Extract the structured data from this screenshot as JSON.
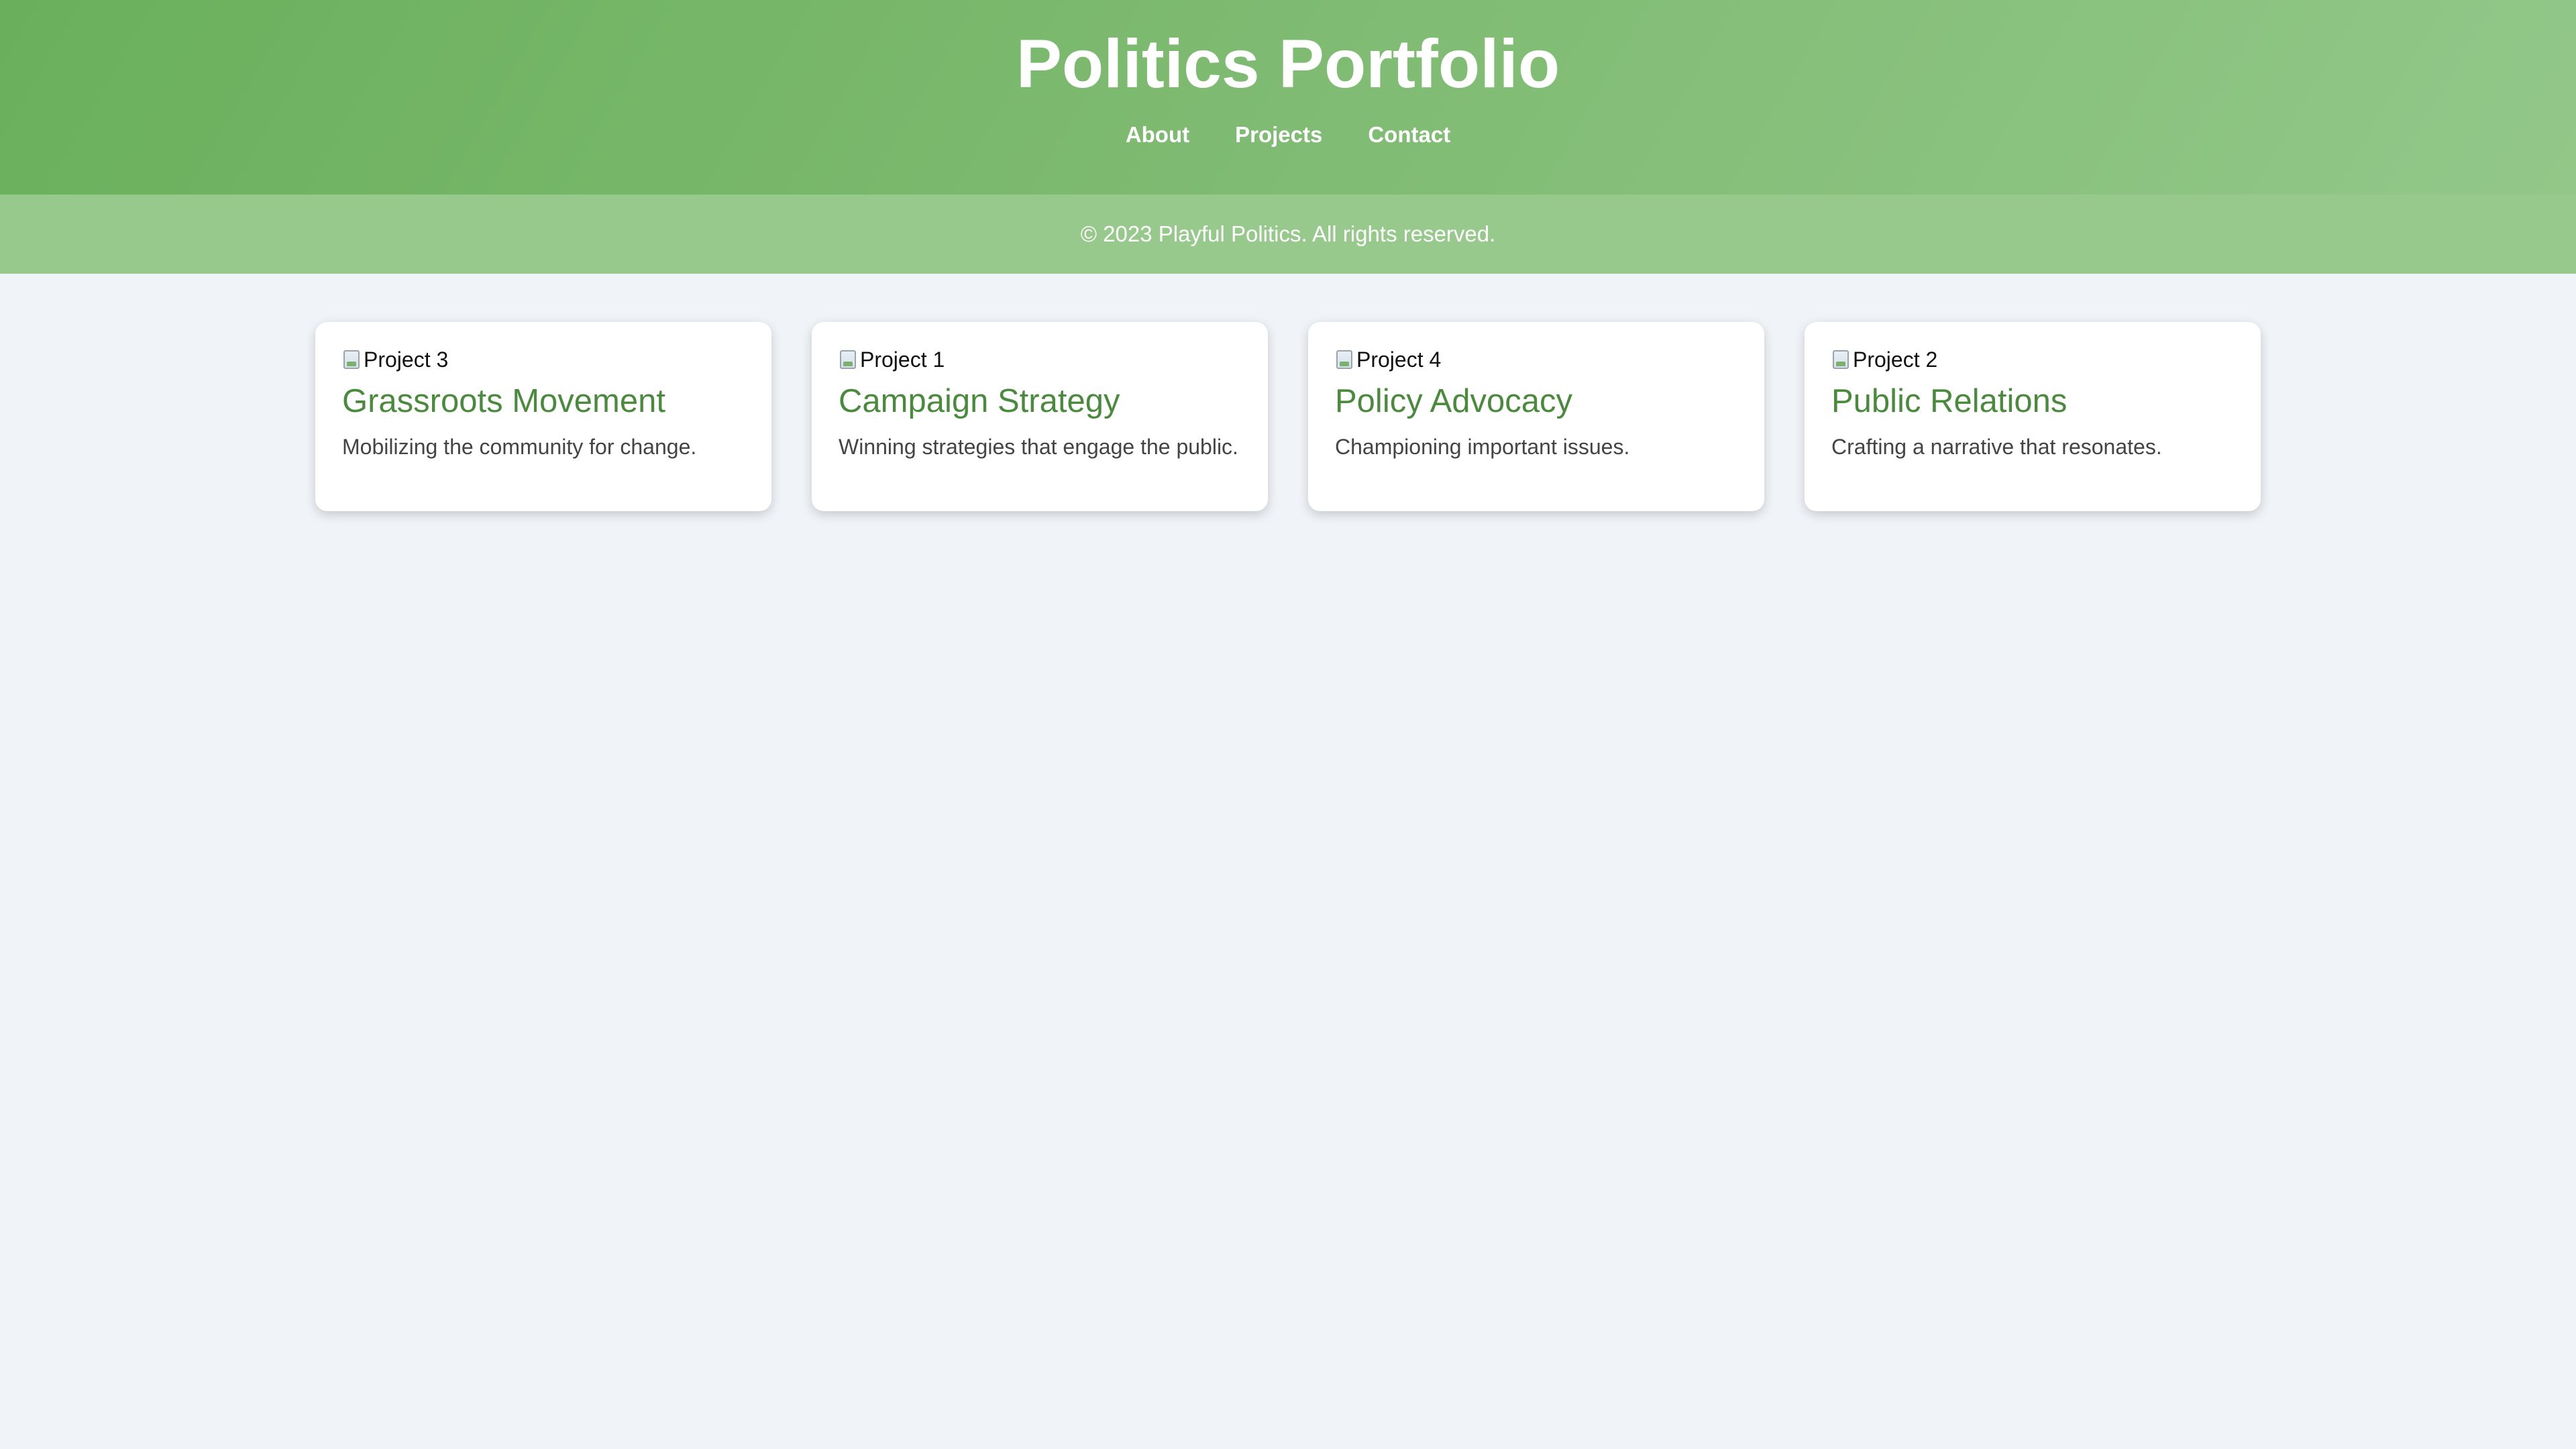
{
  "header": {
    "title": "Politics Portfolio",
    "nav": [
      "About",
      "Projects",
      "Contact"
    ]
  },
  "footer": {
    "text": "© 2023 Playful Politics. All rights reserved."
  },
  "projects": [
    {
      "image_alt": "Project 3",
      "title": "Grassroots Movement",
      "description": "Mobilizing the community for change."
    },
    {
      "image_alt": "Project 1",
      "title": "Campaign Strategy",
      "description": "Winning strategies that engage the public."
    },
    {
      "image_alt": "Project 4",
      "title": "Policy Advocacy",
      "description": "Championing important issues."
    },
    {
      "image_alt": "Project 2",
      "title": "Public Relations",
      "description": "Crafting a narrative that resonates."
    }
  ],
  "colors": {
    "header_start": "#6ab05c",
    "header_end": "#92c789",
    "footer_bar": "#96c98b",
    "card_title": "#4a8a3c",
    "page_background": "#f0f4f8"
  },
  "icons": {
    "card_image": "broken-image-icon"
  }
}
